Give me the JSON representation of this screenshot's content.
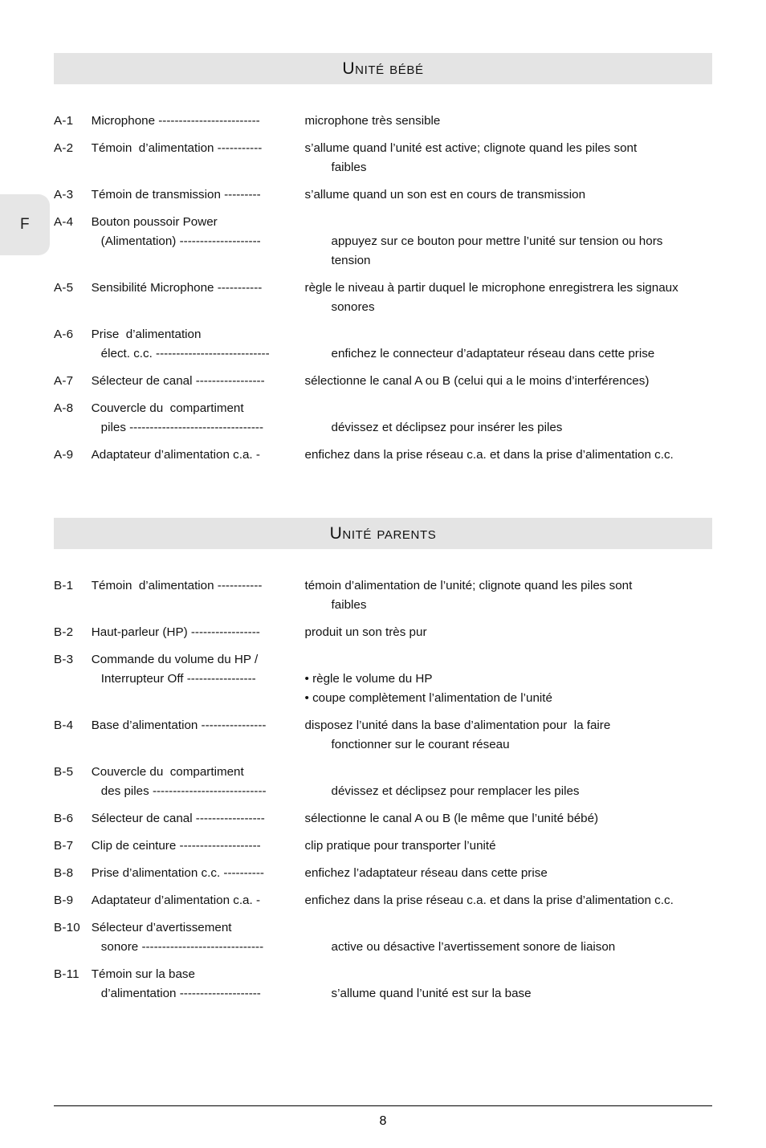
{
  "language_tab": {
    "label": "F"
  },
  "footer": {
    "page_number": "8"
  },
  "sections": [
    {
      "id": "unite-bebe",
      "title": "Unité bébé",
      "entries": [
        {
          "ref": "A-1",
          "term_lines": [
            "Microphone -------------------------"
          ],
          "desc_lines": [
            "microphone très sensible"
          ]
        },
        {
          "ref": "A-2",
          "term_lines": [
            "Témoin  d’alimentation -----------"
          ],
          "desc_lines": [
            "s’allume quand l’unité est active; clignote quand les piles sont",
            "faibles"
          ]
        },
        {
          "ref": "A-3",
          "term_lines": [
            "Témoin de transmission ---------"
          ],
          "desc_lines": [
            "s’allume quand un son est en cours de transmission"
          ]
        },
        {
          "ref": "A-4",
          "term_lines": [
            "Bouton poussoir Power",
            "(Alimentation) --------------------"
          ],
          "desc_lines": [
            "",
            "appuyez sur ce bouton pour mettre l’unité sur tension ou hors",
            "tension"
          ]
        },
        {
          "ref": "A-5",
          "term_lines": [
            "Sensibilité Microphone -----------"
          ],
          "desc_lines": [
            "règle le niveau à partir duquel le microphone enregistrera les signaux",
            "sonores"
          ]
        },
        {
          "ref": "A-6",
          "term_lines": [
            "Prise  d’alimentation",
            "élect. c.c. ----------------------------"
          ],
          "desc_lines": [
            "",
            "enfichez le connecteur d’adaptateur réseau dans cette prise"
          ]
        },
        {
          "ref": "A-7",
          "term_lines": [
            "Sélecteur de canal -----------------"
          ],
          "desc_lines": [
            "sélectionne le canal A ou B (celui qui a le moins d’interférences)"
          ]
        },
        {
          "ref": "A-8",
          "term_lines": [
            "Couvercle du  compartiment",
            "piles ---------------------------------"
          ],
          "desc_lines": [
            "",
            "dévissez et déclipsez pour insérer les piles"
          ]
        },
        {
          "ref": "A-9",
          "term_lines": [
            "Adaptateur d’alimentation c.a. -"
          ],
          "desc_lines": [
            "enfichez dans la prise réseau c.a. et dans la prise d’alimentation c.c."
          ]
        }
      ]
    },
    {
      "id": "unite-parents",
      "title": "Unité parents",
      "entries": [
        {
          "ref": "B-1",
          "term_lines": [
            "Témoin  d’alimentation -----------"
          ],
          "desc_lines": [
            "témoin d’alimentation de l’unité; clignote quand les piles sont",
            "faibles"
          ]
        },
        {
          "ref": "B-2",
          "term_lines": [
            "Haut-parleur (HP) -----------------"
          ],
          "desc_lines": [
            "produit un son très pur"
          ]
        },
        {
          "ref": "B-3",
          "term_lines": [
            "Commande du volume du HP /",
            "Interrupteur Off -----------------"
          ],
          "desc_lines": [
            "",
            "• règle le volume du HP",
            "• coupe complètement l’alimentation de l’unité"
          ]
        },
        {
          "ref": "B-4",
          "term_lines": [
            "Base d’alimentation ----------------"
          ],
          "desc_lines": [
            "disposez l’unité dans la base d’alimentation pour  la faire",
            "fonctionner sur le courant réseau"
          ]
        },
        {
          "ref": "B-5",
          "term_lines": [
            "Couvercle du  compartiment",
            "des piles ----------------------------"
          ],
          "desc_lines": [
            "",
            "dévissez et déclipsez pour remplacer les piles"
          ]
        },
        {
          "ref": "B-6",
          "term_lines": [
            "Sélecteur de canal -----------------"
          ],
          "desc_lines": [
            "sélectionne le canal A ou B (le même que l’unité bébé)"
          ]
        },
        {
          "ref": "B-7",
          "term_lines": [
            "Clip de ceinture --------------------"
          ],
          "desc_lines": [
            "clip pratique pour transporter l’unité"
          ]
        },
        {
          "ref": "B-8",
          "term_lines": [
            "Prise d’alimentation c.c. ----------"
          ],
          "desc_lines": [
            "enfichez l’adaptateur réseau dans cette prise"
          ]
        },
        {
          "ref": "B-9",
          "term_lines": [
            "Adaptateur d’alimentation c.a. -"
          ],
          "desc_lines": [
            "enfichez dans la prise réseau c.a. et dans la prise d’alimentation c.c."
          ]
        },
        {
          "ref": "B-10",
          "term_lines": [
            "Sélecteur d’avertissement",
            "sonore ------------------------------"
          ],
          "desc_lines": [
            "",
            "active ou désactive l’avertissement sonore de liaison"
          ]
        },
        {
          "ref": "B-11",
          "term_lines": [
            "Témoin sur la base",
            "d’alimentation --------------------"
          ],
          "desc_lines": [
            "",
            "s’allume quand l’unité est sur la base"
          ]
        }
      ]
    }
  ]
}
